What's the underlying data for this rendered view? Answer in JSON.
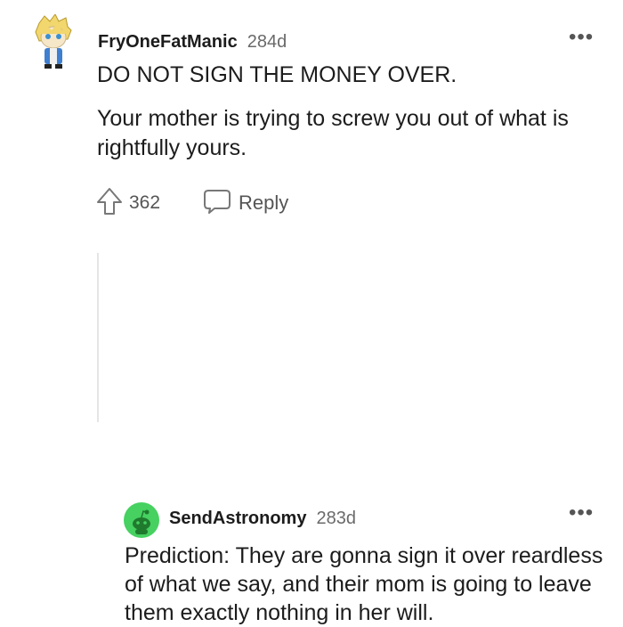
{
  "comment": {
    "username": "FryOneFatManic",
    "age": "284d",
    "more_label": "•••",
    "paragraphs": [
      "DO NOT SIGN THE MONEY OVER.",
      "Your mother is trying to screw you out of what is rightfully yours."
    ],
    "upvotes": "362",
    "reply_label": "Reply",
    "icons": {
      "avatar": "avatar-icon",
      "upvote": "upvote-arrow-icon",
      "reply": "speech-bubble-icon",
      "more": "more-options-icon"
    }
  },
  "reply": {
    "username": "SendAstronomy",
    "age": "283d",
    "more_label": "•••",
    "text": "Prediction: They are gonna sign it over reardless of what we say, and their mom is going to leave them exactly nothing in her will.",
    "icons": {
      "avatar": "avatar-icon"
    }
  },
  "colors": {
    "text": "#1c1c1c",
    "muted": "#6a6a6a",
    "avatar_green": "#46d160"
  }
}
